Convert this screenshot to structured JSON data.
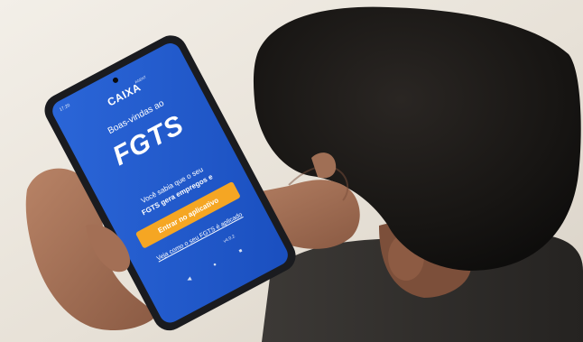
{
  "colors": {
    "screen_blue": "#1f5bd0",
    "accent_orange": "#f5a623",
    "wall": "#ece7df"
  },
  "app": {
    "status_time": "17:20",
    "brand": "CAIXA",
    "brand_sub": "AGENT",
    "welcome": "Boas-vindas ao",
    "logo": "FGTS",
    "info_line1": "Você sabia que o seu",
    "info_line2": "FGTS gera empregos e",
    "enter_button": "Entrar no aplicativo",
    "see_link": "Veja como o seu FGTS é aplicado",
    "version": "v4.0.2"
  },
  "icons": [
    "back-icon",
    "home-icon",
    "recent-apps-icon"
  ]
}
